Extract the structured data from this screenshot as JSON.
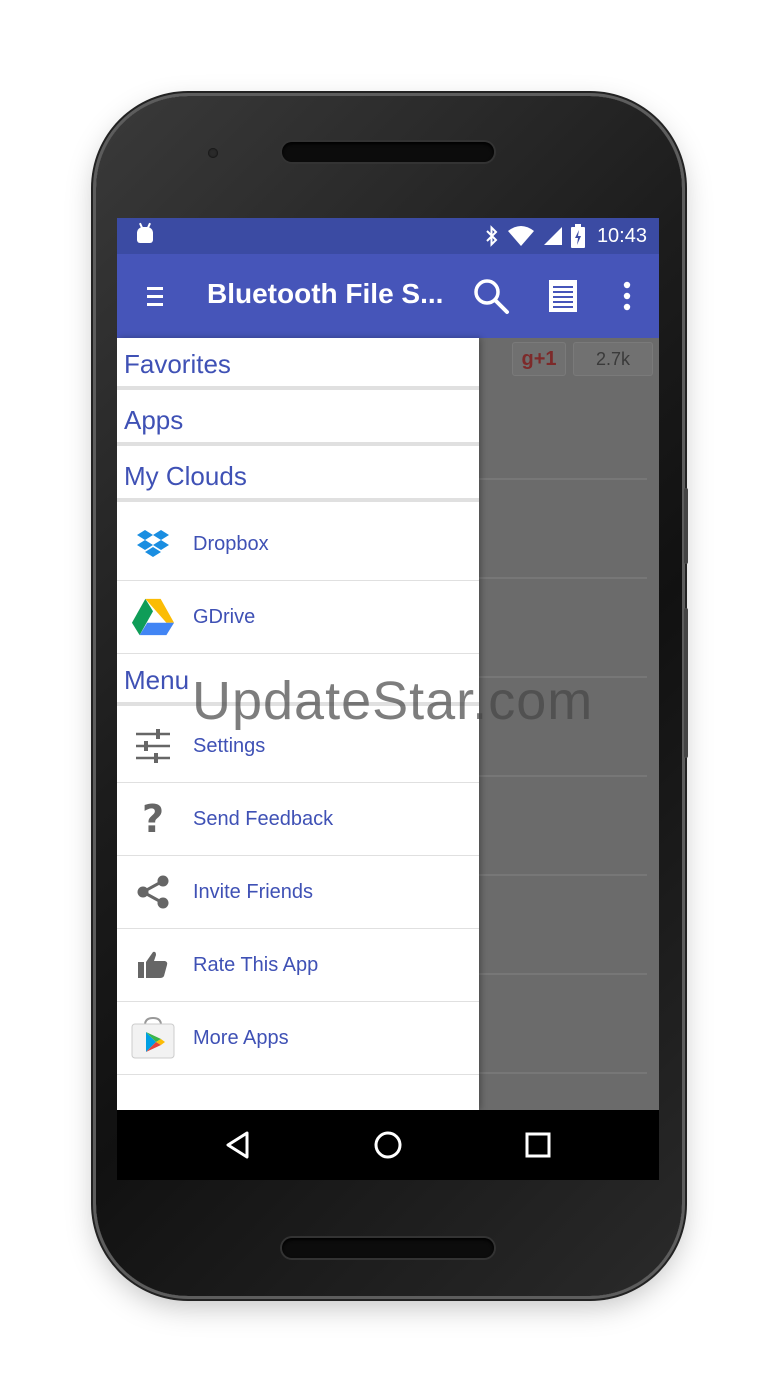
{
  "status_bar": {
    "time": "10:43",
    "icons": [
      "android-icon",
      "bluetooth-icon",
      "wifi-icon",
      "signal-icon",
      "battery-icon"
    ]
  },
  "toolbar": {
    "title": "Bluetooth File S...",
    "icons": [
      "menu-icon",
      "search-icon",
      "list-view-icon",
      "overflow-menu-icon"
    ],
    "color": "#4655b9"
  },
  "background_content": {
    "gplus_label": "g+1",
    "count": "2.7k"
  },
  "drawer": {
    "favorites": "Favorites",
    "apps": "Apps",
    "my_clouds": "My Clouds",
    "clouds": [
      {
        "label": "Dropbox",
        "icon": "dropbox-icon"
      },
      {
        "label": "GDrive",
        "icon": "gdrive-icon"
      }
    ],
    "menu": "Menu",
    "menu_items": [
      {
        "label": "Settings",
        "icon": "settings-icon"
      },
      {
        "label": "Send Feedback",
        "icon": "question-icon"
      },
      {
        "label": "Invite Friends",
        "icon": "share-icon"
      },
      {
        "label": "Rate This App",
        "icon": "thumbs-up-icon"
      },
      {
        "label": "More Apps",
        "icon": "play-store-icon"
      }
    ],
    "accent": "#3f51b5"
  },
  "nav_bar": {
    "icons": [
      "back-icon",
      "home-icon",
      "recents-icon"
    ]
  },
  "watermark": "UpdateStar.com"
}
